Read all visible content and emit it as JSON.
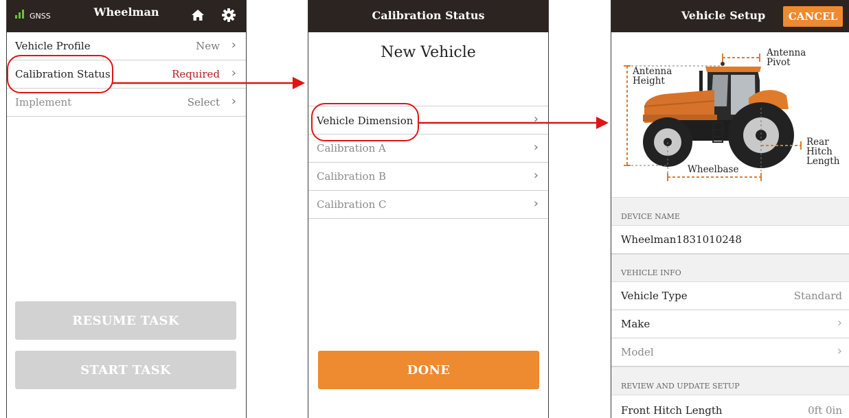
{
  "screen1": {
    "gnss_label": "GNSS",
    "title": "Wheelman",
    "rows": [
      {
        "label": "Vehicle Profile",
        "value": "New"
      },
      {
        "label": "Calibration Status",
        "value": "Required"
      },
      {
        "label": "Implement",
        "value": "Select"
      }
    ],
    "resume_task": "RESUME TASK",
    "start_task": "START TASK"
  },
  "screen2": {
    "title": "Calibration Status",
    "subtitle": "New Vehicle",
    "rows": [
      {
        "label": "Vehicle Dimension"
      },
      {
        "label": "Calibration A"
      },
      {
        "label": "Calibration B"
      },
      {
        "label": "Calibration C"
      }
    ],
    "done": "DONE"
  },
  "screen3": {
    "title": "Vehicle Setup",
    "cancel": "CANCEL",
    "diagram_labels": {
      "antenna_pivot": "Antenna Pivot",
      "antenna_height": "Antenna Height",
      "rear_hitch_length": "Rear Hitch Length",
      "wheelbase": "Wheelbase"
    },
    "device_name_header": "DEVICE NAME",
    "device_name": "Wheelman1831010248",
    "vehicle_info_header": "VEHICLE INFO",
    "vehicle_type_label": "Vehicle Type",
    "vehicle_type_value": "Standard",
    "make_label": "Make",
    "model_label": "Model",
    "review_header": "REVIEW AND UPDATE SETUP",
    "front_hitch_label": "Front Hitch Length",
    "front_hitch_value": "0ft 0in"
  },
  "colors": {
    "topbar": "#2b2420",
    "accent_orange": "#ee8a30",
    "required_red": "#b61b1b",
    "callout_red": "#e01414",
    "gnss_green": "#6cc33b"
  }
}
